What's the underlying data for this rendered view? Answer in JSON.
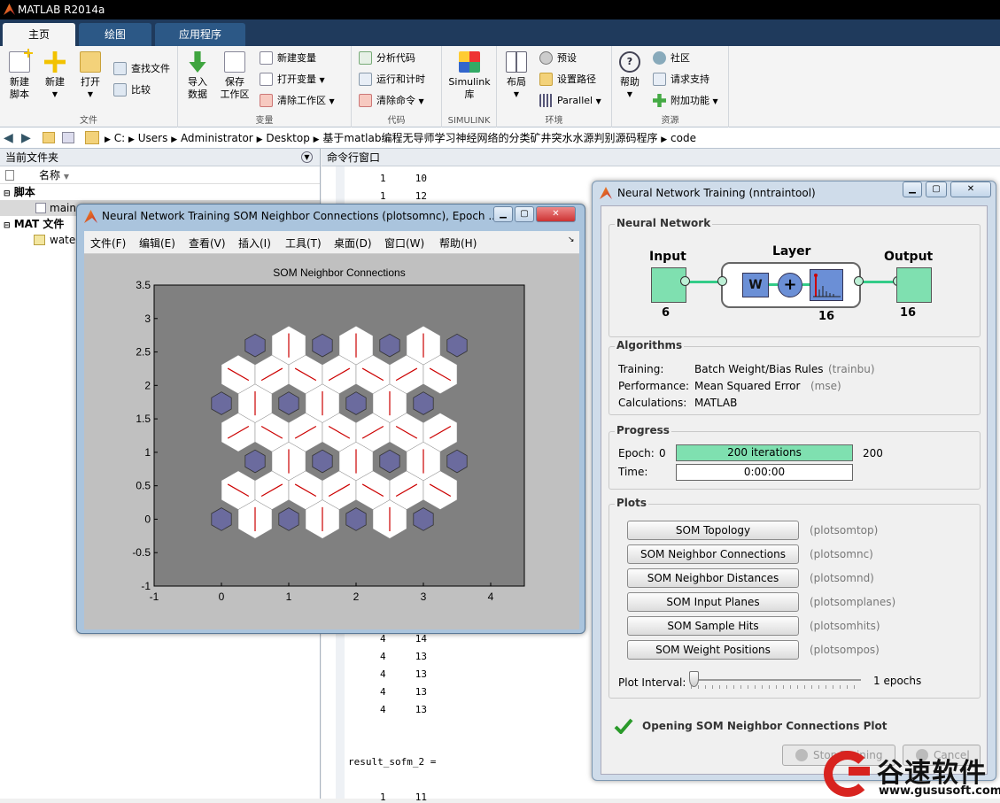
{
  "app": {
    "title": "MATLAB R2014a"
  },
  "tabs": [
    "主页",
    "绘图",
    "应用程序"
  ],
  "ribbon": {
    "file": {
      "label": "文件",
      "new_script": "新建\n脚本",
      "new": "新建",
      "open": "打开",
      "find_files": "查找文件",
      "compare": "比较"
    },
    "variable": {
      "label": "变量",
      "import": "导入\n数据",
      "save_ws": "保存\n工作区",
      "new_var": "新建变量",
      "open_var": "打开变量",
      "clear_ws": "清除工作区"
    },
    "code": {
      "label": "代码",
      "analyze": "分析代码",
      "run_time": "运行和计时",
      "clear_cmd": "清除命令"
    },
    "simulink": {
      "label": "SIMULINK",
      "lib": "Simulink\n库"
    },
    "env": {
      "label": "环境",
      "layout": "布局",
      "prefs": "预设",
      "set_path": "设置路径",
      "parallel": "Parallel"
    },
    "resources": {
      "label": "资源",
      "help": "帮助",
      "community": "社区",
      "support": "请求支持",
      "addons": "附加功能"
    }
  },
  "address": {
    "parts": [
      "C:",
      "Users",
      "Administrator",
      "Desktop",
      "基于matlab编程无导师学习神经网络的分类矿井突水水源判别源码程序",
      "code"
    ]
  },
  "left_panel": {
    "title": "当前文件夹",
    "col_name": "名称",
    "groups": [
      {
        "name": "脚本",
        "items": [
          "main"
        ]
      },
      {
        "name": "MAT 文件",
        "items": [
          "wate"
        ]
      }
    ]
  },
  "command_window": {
    "title": "命令行窗口",
    "top_lines": [
      "1     10",
      "1     12"
    ],
    "mid_lines": [
      "4     14",
      "4     13",
      "4     13",
      "4     13",
      "4     13"
    ],
    "result": "result_sofm_2 =",
    "bottom_line": "1     11"
  },
  "som_window": {
    "title": "Neural Network Training SOM Neighbor Connections (plotsomnc), Epoch ...",
    "menus": [
      "文件(F)",
      "编辑(E)",
      "查看(V)",
      "插入(I)",
      "工具(T)",
      "桌面(D)",
      "窗口(W)",
      "帮助(H)"
    ],
    "chart_data": {
      "type": "scatter",
      "title": "SOM Neighbor Connections",
      "xlim": [
        -1,
        4.5
      ],
      "ylim": [
        -1,
        3.5
      ],
      "xticks": [
        "-1",
        "0",
        "1",
        "2",
        "3",
        "4"
      ],
      "yticks": [
        "-1",
        "-0.5",
        "0",
        "0.5",
        "1",
        "1.5",
        "2",
        "2.5",
        "3",
        "3.5"
      ],
      "neuron_rows": [
        {
          "y": 0,
          "x": [
            0,
            1,
            2,
            3
          ]
        },
        {
          "y": 0.866,
          "x": [
            0.5,
            1.5,
            2.5,
            3.5
          ]
        },
        {
          "y": 1.732,
          "x": [
            0,
            1,
            2,
            3
          ]
        },
        {
          "y": 2.598,
          "x": [
            0.5,
            1.5,
            2.5,
            3.5
          ]
        }
      ],
      "background_color": "#808080",
      "neuron_color": "#6b6b9e",
      "connection_color": "#cc0000"
    }
  },
  "nn_window": {
    "title": "Neural Network Training (nntraintool)",
    "network": {
      "title": "Neural Network",
      "input": "Input",
      "input_size": "6",
      "layer": "Layer",
      "layer_size": "16",
      "output": "Output",
      "output_size": "16",
      "w": "W",
      "plus": "+"
    },
    "algorithms": {
      "title": "Algorithms",
      "rows": [
        {
          "label": "Training:",
          "value": "Batch Weight/Bias Rules",
          "code": "(trainbu)"
        },
        {
          "label": "Performance:",
          "value": "Mean Squared Error",
          "code": "(mse)"
        },
        {
          "label": "Calculations:",
          "value": "MATLAB",
          "code": ""
        }
      ]
    },
    "progress": {
      "title": "Progress",
      "epoch_label": "Epoch:",
      "epoch_min": "0",
      "epoch_text": "200 iterations",
      "epoch_max": "200",
      "epoch_fraction": 1.0,
      "time_label": "Time:",
      "time_value": "0:00:00"
    },
    "plots": {
      "title": "Plots",
      "buttons": [
        {
          "label": "SOM Topology",
          "code": "(plotsomtop)"
        },
        {
          "label": "SOM Neighbor Connections",
          "code": "(plotsomnc)"
        },
        {
          "label": "SOM Neighbor Distances",
          "code": "(plotsomnd)"
        },
        {
          "label": "SOM Input Planes",
          "code": "(plotsomplanes)"
        },
        {
          "label": "SOM Sample Hits",
          "code": "(plotsomhits)"
        },
        {
          "label": "SOM Weight Positions",
          "code": "(plotsompos)"
        }
      ],
      "interval_label": "Plot Interval:",
      "interval_value": "1 epochs"
    },
    "status": "Opening SOM Neighbor Connections Plot",
    "stop_btn": "Stop Training",
    "cancel_btn": "Cancel"
  },
  "watermark": {
    "brand": "谷速软件",
    "url": "www.gususoft.com"
  }
}
